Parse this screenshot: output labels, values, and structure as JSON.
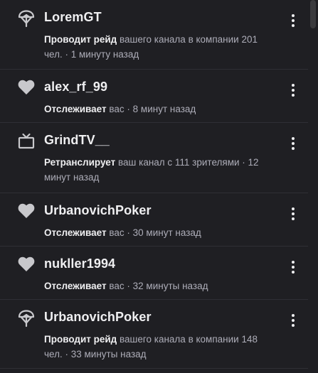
{
  "notifications": [
    {
      "icon": "raid-icon",
      "user": "LoremGT",
      "action": "Проводит рейд",
      "rest": " вашего канала в компании 201 чел.",
      "sep": " · ",
      "time": "1 минуту назад"
    },
    {
      "icon": "heart-icon",
      "user": "alex_rf_99",
      "action": "Отслеживает",
      "rest": " вас",
      "sep": " · ",
      "time": "8 минут назад"
    },
    {
      "icon": "tv-icon",
      "user": "GrindTV__",
      "action": "Ретранслирует",
      "rest": " ваш канал с 111 зрителями",
      "sep": " · ",
      "time": "12 минут назад"
    },
    {
      "icon": "heart-icon",
      "user": "UrbanovichPoker",
      "action": "Отслеживает",
      "rest": " вас",
      "sep": " · ",
      "time": "30 минут назад"
    },
    {
      "icon": "heart-icon",
      "user": "nukller1994",
      "action": "Отслеживает",
      "rest": " вас",
      "sep": " · ",
      "time": "32 минуты назад"
    },
    {
      "icon": "raid-icon",
      "user": "UrbanovichPoker",
      "action": "Проводит рейд",
      "rest": " вашего канала в компании 148 чел.",
      "sep": " · ",
      "time": "33 минуты назад"
    }
  ]
}
